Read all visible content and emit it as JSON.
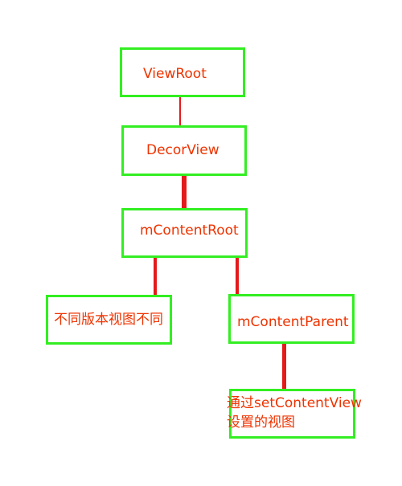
{
  "colors": {
    "node_border": "#33ee22",
    "node_text": "#ee3300",
    "edge": "#e31b1b",
    "background": "#ffffff"
  },
  "nodes": {
    "view_root": {
      "label": "ViewRoot"
    },
    "decor_view": {
      "label": "DecorView"
    },
    "content_root": {
      "label": "mContentRoot"
    },
    "version_dependent_view": {
      "label": "不同版本视图不同"
    },
    "content_parent": {
      "label": "mContentParent"
    },
    "set_content_view": {
      "label_line1": "通过setContentView",
      "label_line2": "设置的视图"
    }
  }
}
